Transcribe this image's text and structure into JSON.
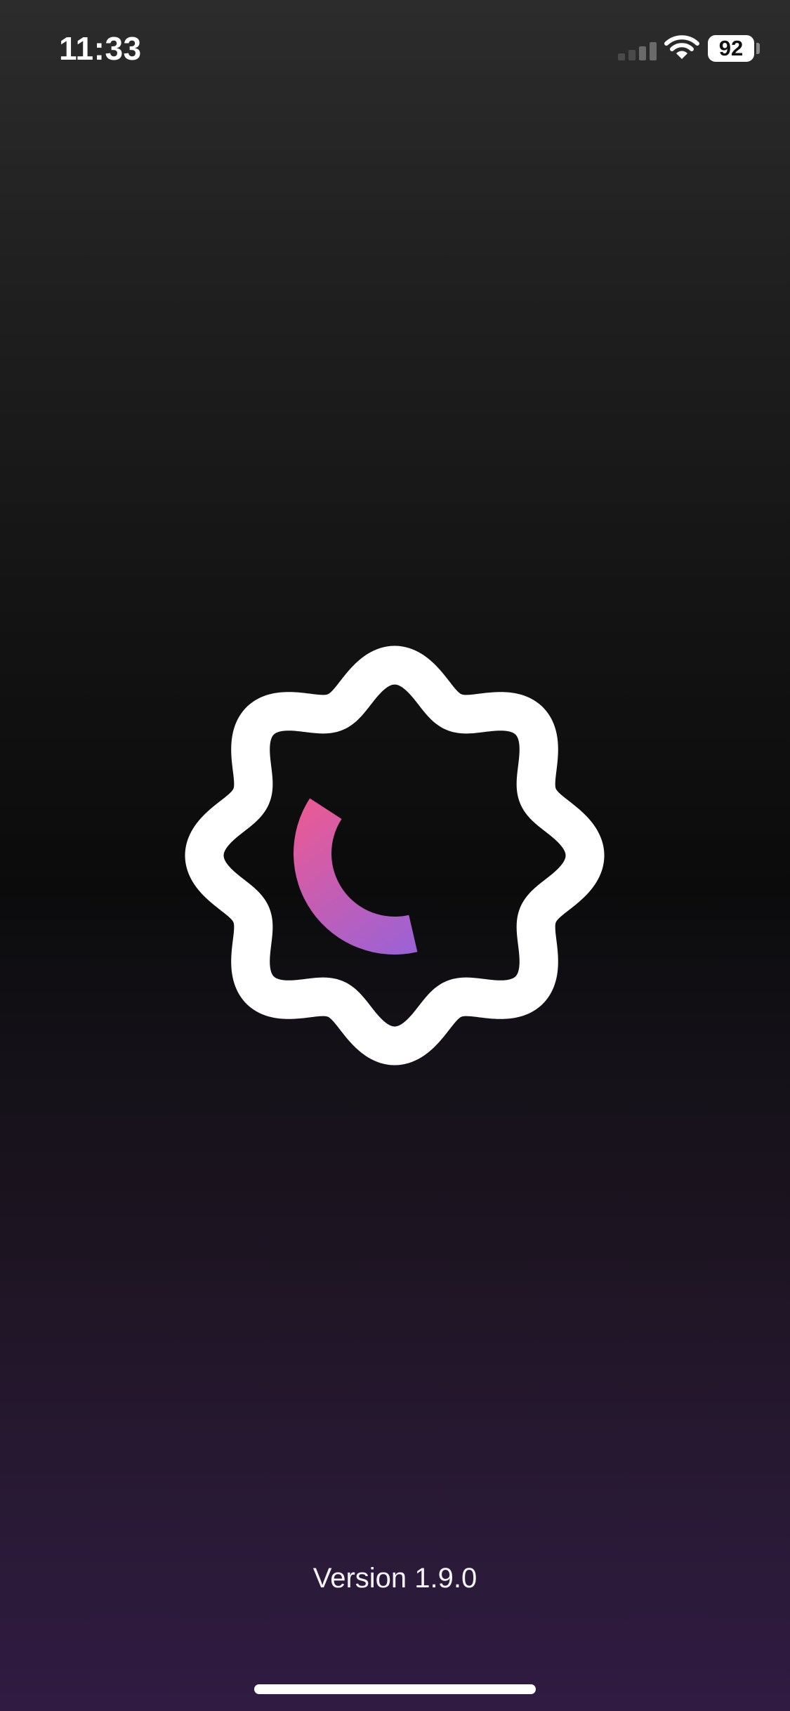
{
  "status_bar": {
    "time": "11:33",
    "battery_level": "92",
    "signal_icon": "cellular-signal-icon",
    "wifi_icon": "wifi-icon",
    "battery_icon": "battery-icon"
  },
  "logo": {
    "icon": "app-logo-icon",
    "badge_color": "#ffffff",
    "gradient_start": "#ea5a95",
    "gradient_end": "#9a62d6"
  },
  "footer": {
    "version_text": "Version 1.9.0"
  },
  "colors": {
    "background_top": "#2c2c2c",
    "background_middle": "#0b0b0c",
    "background_bottom": "#301b42"
  }
}
